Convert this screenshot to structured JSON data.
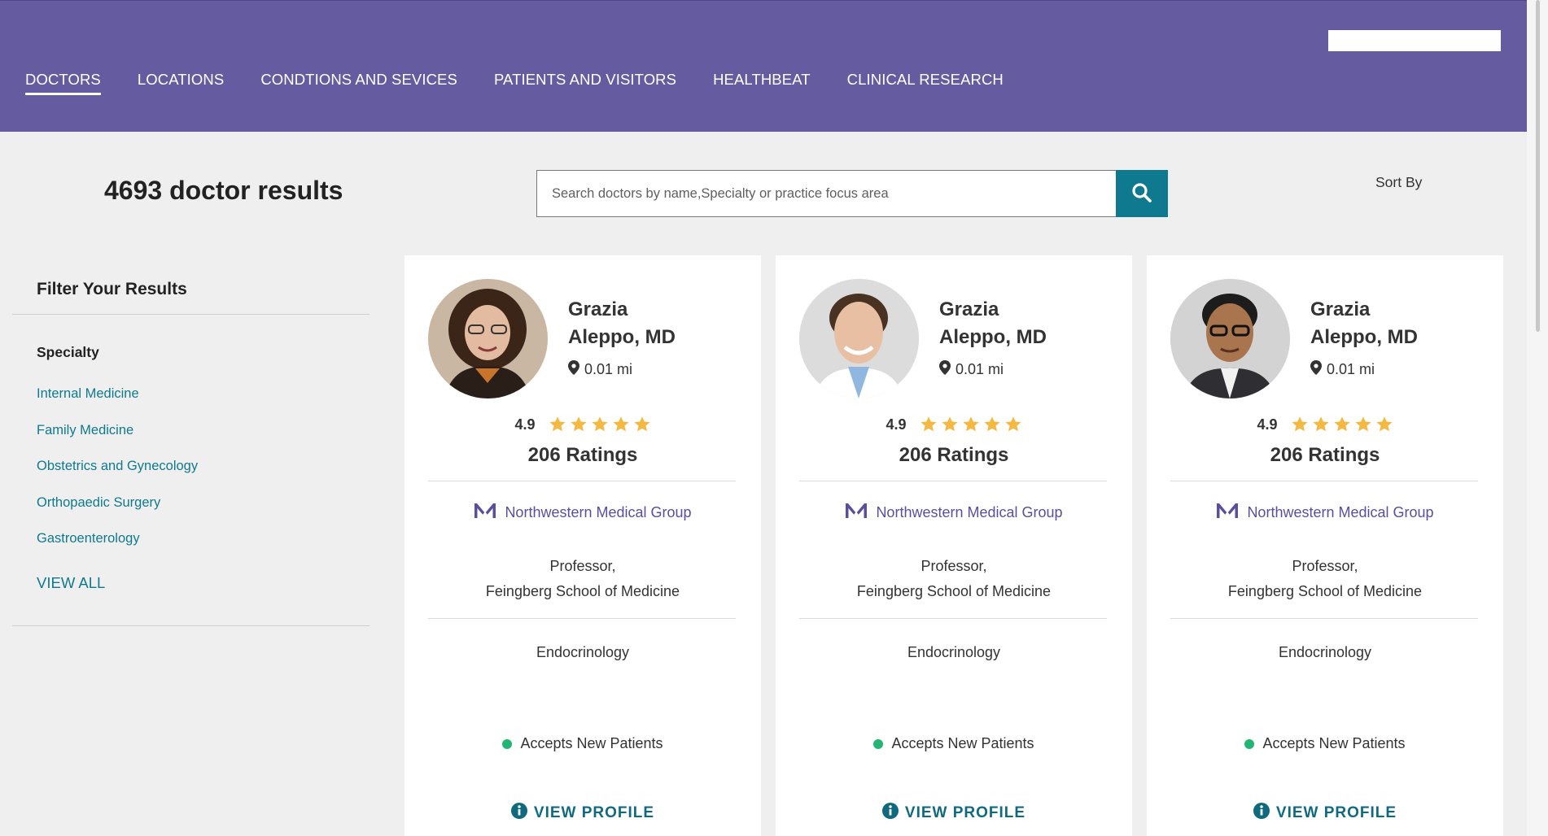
{
  "header": {
    "top_input_value": "",
    "nav": [
      {
        "label": "DOCTORS",
        "active": true
      },
      {
        "label": "LOCATIONS"
      },
      {
        "label": "CONDTIONS AND SEVICES"
      },
      {
        "label": "PATIENTS AND VISITORS"
      },
      {
        "label": "HEALTHBEAT"
      },
      {
        "label": "CLINICAL RESEARCH"
      }
    ]
  },
  "search": {
    "results_count": "4693 doctor results",
    "placeholder": "Search doctors by name,Specialty or practice focus area",
    "value": "",
    "sort_label": "Sort By"
  },
  "filter": {
    "title": "Filter Your Results",
    "section": "Specialty",
    "items": [
      "Internal Medicine",
      "Family Medicine",
      "Obstetrics and Gynecology",
      "Orthopaedic Surgery",
      "Gastroenterology"
    ],
    "view_all": "VIEW ALL"
  },
  "doctors": [
    {
      "first_name": "Grazia",
      "last_name": "Aleppo, MD",
      "distance": "0.01 mi",
      "rating": "4.9",
      "stars": 5,
      "ratings": "206 Ratings",
      "group": "Northwestern Medical Group",
      "title_line1": "Professor,",
      "title_line2": "Feingberg School of Medicine",
      "specialty": "Endocrinology",
      "accepts": "Accepts New Patients",
      "cta": "VIEW PROFILE",
      "photo_icon": "doctor-photo-woman"
    },
    {
      "first_name": "Grazia",
      "last_name": "Aleppo, MD",
      "distance": "0.01 mi",
      "rating": "4.9",
      "stars": 5,
      "ratings": "206 Ratings",
      "group": "Northwestern Medical Group",
      "title_line1": "Professor,",
      "title_line2": "Feingberg School of Medicine",
      "specialty": "Endocrinology",
      "accepts": "Accepts New Patients",
      "cta": "VIEW PROFILE",
      "photo_icon": "doctor-photo-man-smiling"
    },
    {
      "first_name": "Grazia",
      "last_name": "Aleppo, MD",
      "distance": "0.01 mi",
      "rating": "4.9",
      "stars": 5,
      "ratings": "206 Ratings",
      "group": "Northwestern Medical Group",
      "title_line1": "Professor,",
      "title_line2": "Feingberg School of Medicine",
      "specialty": "Endocrinology",
      "accepts": "Accepts New Patients",
      "cta": "VIEW PROFILE",
      "photo_icon": "doctor-photo-man-glasses"
    }
  ],
  "colors": {
    "header_bg": "#655ba1",
    "accent_teal": "#0f7a8f",
    "star": "#f5b942",
    "accepting": "#22b573",
    "group_purple": "#5b4f9c"
  }
}
